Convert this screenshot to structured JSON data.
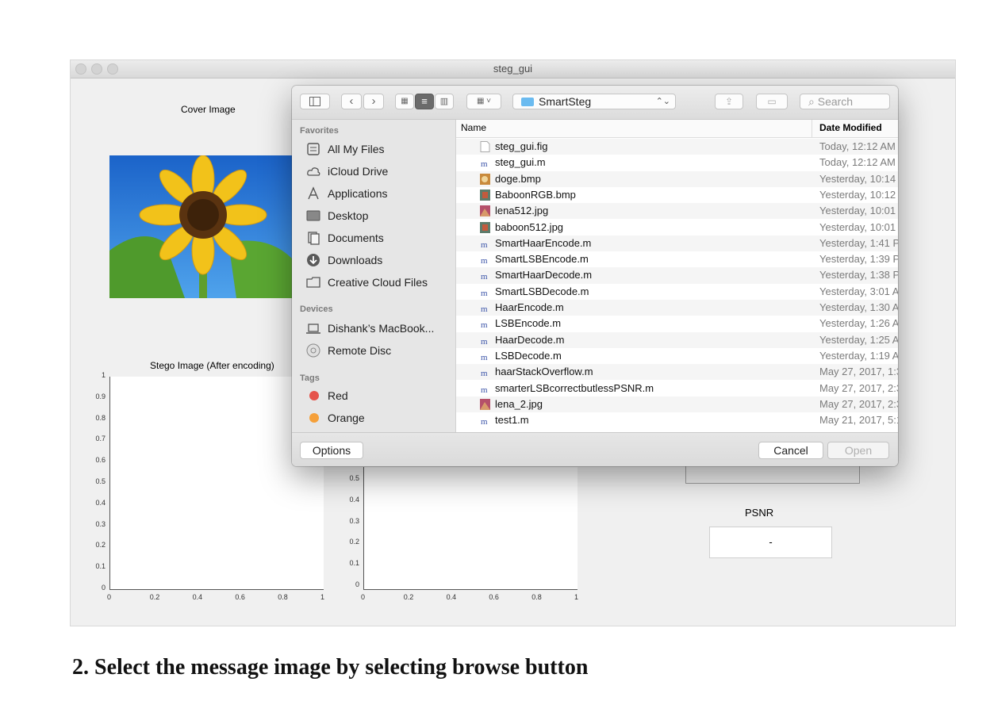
{
  "window": {
    "title": "steg_gui"
  },
  "gui": {
    "cover_label": "Cover Image",
    "stego_label": "Stego Image (After encoding)",
    "psnr_label": "PSNR",
    "psnr_value": "-",
    "y_ticks": [
      "1",
      "0.9",
      "0.8",
      "0.7",
      "0.6",
      "0.5",
      "0.4",
      "0.3",
      "0.2",
      "0.1",
      "0"
    ],
    "y_ticks_partial": [
      "0.5",
      "0.4",
      "0.3",
      "0.2",
      "0.1",
      "0"
    ],
    "x_ticks": [
      "0",
      "0.2",
      "0.4",
      "0.6",
      "0.8",
      "1"
    ]
  },
  "dialog": {
    "path_label": "SmartSteg",
    "search_placeholder": "Search",
    "columns": {
      "name": "Name",
      "date": "Date Modified"
    },
    "sidebar": {
      "favorites_title": "Favorites",
      "favorites": [
        {
          "label": "All My Files",
          "icon": "all-files-icon"
        },
        {
          "label": "iCloud Drive",
          "icon": "cloud-icon"
        },
        {
          "label": "Applications",
          "icon": "applications-icon"
        },
        {
          "label": "Desktop",
          "icon": "desktop-icon"
        },
        {
          "label": "Documents",
          "icon": "documents-icon"
        },
        {
          "label": "Downloads",
          "icon": "downloads-icon"
        },
        {
          "label": "Creative Cloud Files",
          "icon": "folder-icon"
        }
      ],
      "devices_title": "Devices",
      "devices": [
        {
          "label": "Dishank’s MacBook...",
          "icon": "laptop-icon"
        },
        {
          "label": "Remote Disc",
          "icon": "disc-icon"
        }
      ],
      "tags_title": "Tags",
      "tags": [
        {
          "label": "Red",
          "color": "#e5534b"
        },
        {
          "label": "Orange",
          "color": "#f5a03a"
        }
      ]
    },
    "files": [
      {
        "name": "steg_gui.fig",
        "date": "Today, 12:12 AM",
        "kind": "doc"
      },
      {
        "name": "steg_gui.m",
        "date": "Today, 12:12 AM",
        "kind": "m"
      },
      {
        "name": "doge.bmp",
        "date": "Yesterday, 10:14",
        "kind": "img-doge"
      },
      {
        "name": "BaboonRGB.bmp",
        "date": "Yesterday, 10:12",
        "kind": "img-baboon"
      },
      {
        "name": "lena512.jpg",
        "date": "Yesterday, 10:01",
        "kind": "img-lena"
      },
      {
        "name": "baboon512.jpg",
        "date": "Yesterday, 10:01",
        "kind": "img-baboon"
      },
      {
        "name": "SmartHaarEncode.m",
        "date": "Yesterday, 1:41 P",
        "kind": "m"
      },
      {
        "name": "SmartLSBEncode.m",
        "date": "Yesterday, 1:39 P",
        "kind": "m"
      },
      {
        "name": "SmartHaarDecode.m",
        "date": "Yesterday, 1:38 P",
        "kind": "m"
      },
      {
        "name": "SmartLSBDecode.m",
        "date": "Yesterday, 3:01 A",
        "kind": "m"
      },
      {
        "name": "HaarEncode.m",
        "date": "Yesterday, 1:30 A",
        "kind": "m"
      },
      {
        "name": "LSBEncode.m",
        "date": "Yesterday, 1:26 A",
        "kind": "m"
      },
      {
        "name": "HaarDecode.m",
        "date": "Yesterday, 1:25 A",
        "kind": "m"
      },
      {
        "name": "LSBDecode.m",
        "date": "Yesterday, 1:19 A",
        "kind": "m"
      },
      {
        "name": "haarStackOverflow.m",
        "date": "May 27, 2017, 1:3",
        "kind": "m"
      },
      {
        "name": "smarterLSBcorrectbutlessPSNR.m",
        "date": "May 27, 2017, 2:3",
        "kind": "m"
      },
      {
        "name": "lena_2.jpg",
        "date": "May 27, 2017, 2:3",
        "kind": "img-lena"
      },
      {
        "name": "test1.m",
        "date": "May 21, 2017, 5:1",
        "kind": "m"
      }
    ],
    "options_label": "Options",
    "cancel_label": "Cancel",
    "open_label": "Open"
  },
  "caption": "2. Select the message image by selecting browse button"
}
